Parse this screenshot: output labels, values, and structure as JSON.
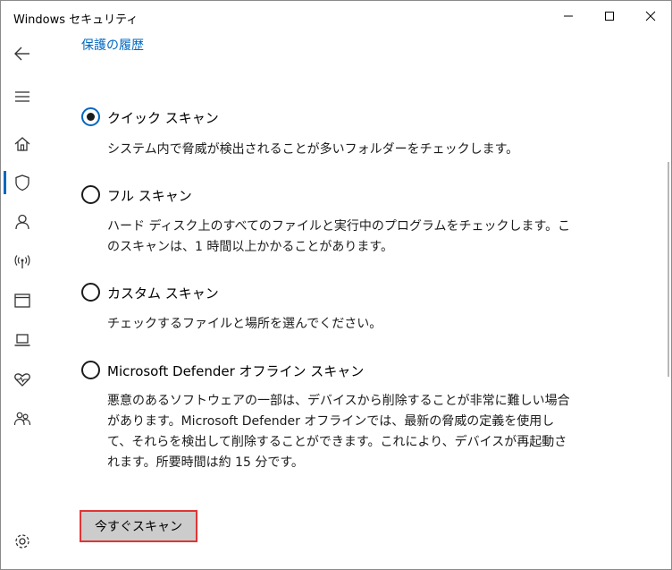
{
  "window": {
    "title": "Windows セキュリティ"
  },
  "breadcrumb": {
    "label": "保護の履歴"
  },
  "options": [
    {
      "label": "クイック スキャン",
      "checked": true,
      "desc": "システム内で脅威が検出されることが多いフォルダーをチェックします。"
    },
    {
      "label": "フル スキャン",
      "checked": false,
      "desc": "ハード ディスク上のすべてのファイルと実行中のプログラムをチェックします。このスキャンは、1 時間以上かかることがあります。"
    },
    {
      "label": "カスタム スキャン",
      "checked": false,
      "desc": "チェックするファイルと場所を選んでください。"
    },
    {
      "label": "Microsoft Defender オフライン スキャン",
      "checked": false,
      "desc": "悪意のあるソフトウェアの一部は、デバイスから削除することが非常に難しい場合があります。Microsoft Defender オフラインでは、最新の脅威の定義を使用して、それらを検出して削除することができます。これにより、デバイスが再起動されます。所要時間は約 15 分です。"
    }
  ],
  "scan_button": {
    "label": "今すぐスキャン"
  },
  "colors": {
    "accent": "#0067c0",
    "highlight": "#e03535"
  },
  "icons": [
    "back-arrow-icon",
    "hamburger-menu-icon",
    "home-icon",
    "shield-icon",
    "account-icon",
    "network-icon",
    "app-browser-icon",
    "device-icon",
    "health-icon",
    "family-icon",
    "settings-icon"
  ]
}
